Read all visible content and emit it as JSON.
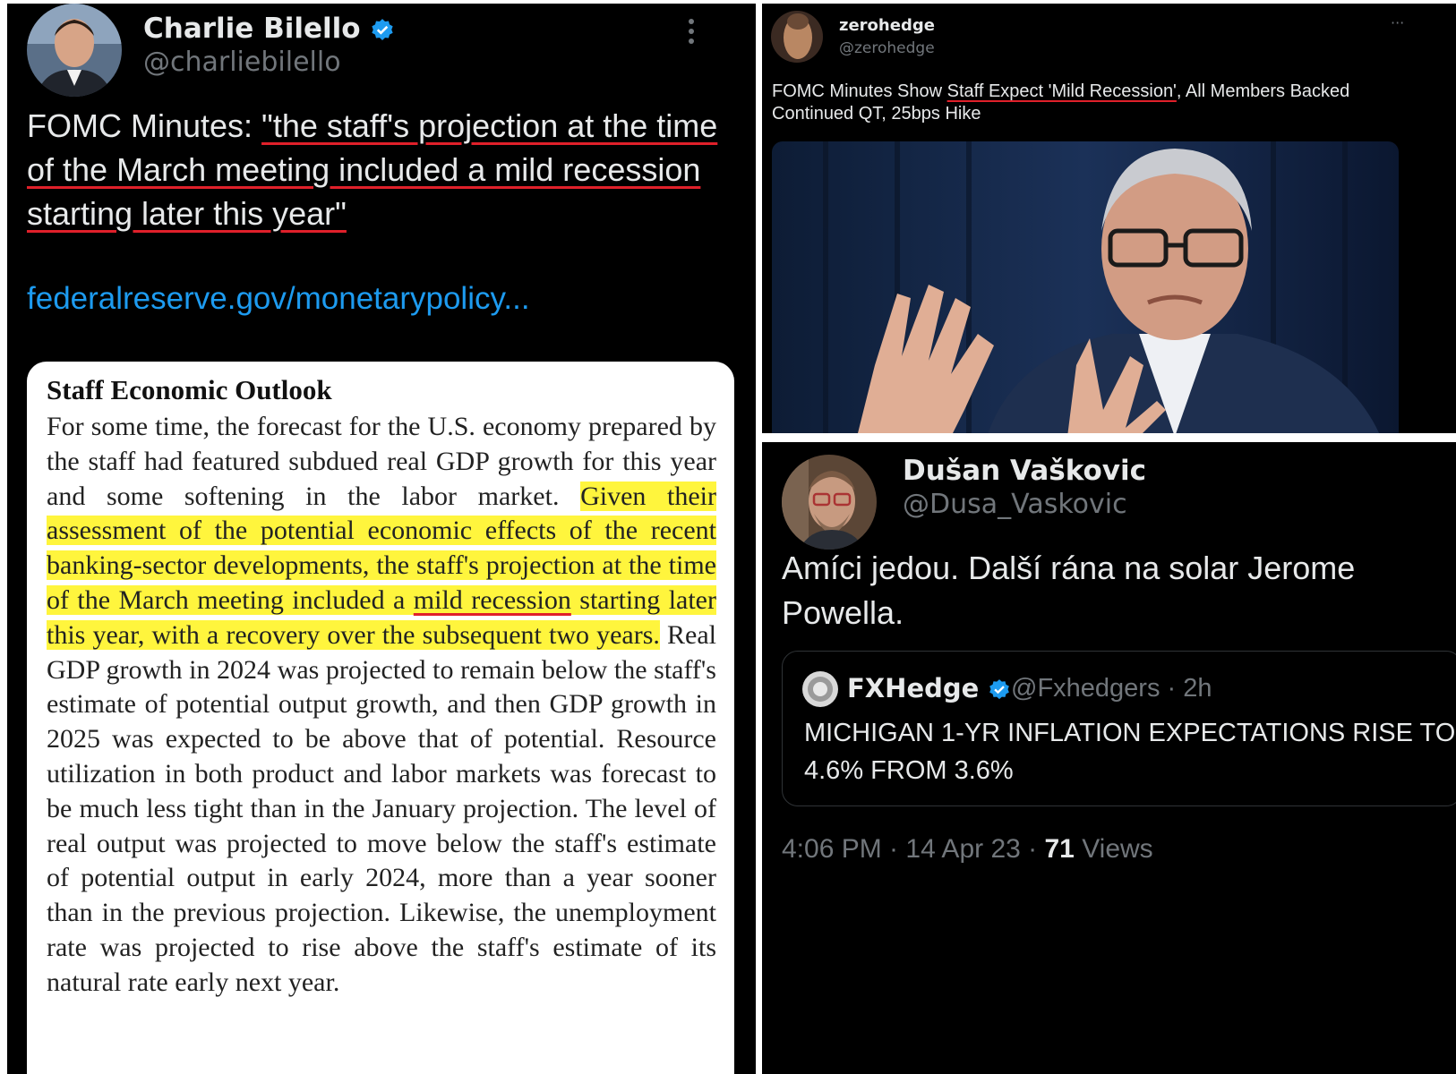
{
  "left_tweet": {
    "name": "Charlie Bilello",
    "handle": "@charliebilello",
    "text_prefix": "FOMC Minutes: ",
    "text_quote": "\"the staff's projection at the time of the March meeting included a mild recession starting later this year\"",
    "link": "federalreserve.gov/monetarypolicy...",
    "document": {
      "title": "Staff Economic Outlook",
      "para_1": "For some time, the forecast for the U.S. economy prepared by the staff had featured subdued real GDP growth for this year and some softening in the labor market. ",
      "hl_1": "Given their assessment of the potential economic effects of the recent banking-sector developments, the staff's projection at the time of the March meeting included a ",
      "hl_underlined": "mild recession",
      "hl_2": " starting later this year, with a recovery over the subsequent two years.",
      "para_2": " Real GDP growth in 2024 was projected to remain below the staff's estimate of potential output growth, and then GDP growth in 2025 was expected to be above that of potential. Resource utilization in both product and labor markets was forecast to be much less tight than in the January projection. The level of real output was projected to move below the staff's estimate of potential output in early 2024, more than a year sooner than in the previous projection. Likewise, the unemployment rate was projected to rise above the staff's estimate of its natural rate early next year."
    }
  },
  "top_right_tweet": {
    "name": "zerohedge",
    "handle": "@zerohedge",
    "more": "···",
    "text_before": "FOMC Minutes Show ",
    "text_underlined": "Staff Expect 'Mild Recession'",
    "text_after": ", All Members Backed Continued QT, 25bps Hike"
  },
  "bottom_right_tweet": {
    "name": "Dušan Vaškovic",
    "handle": "@Dusa_Vaskovic",
    "text": "Amíci jedou. Další rána na solar Jerome Powella.",
    "quoted": {
      "name": "FXHedge",
      "handle": "@Fxhedgers",
      "age": "· 2h",
      "text": "MICHIGAN 1-YR INFLATION EXPECTATIONS RISE TO 4.6% FROM 3.6%"
    },
    "time": "4:06 PM · 14 Apr 23 · ",
    "views_count": "71",
    "views_label": " Views"
  },
  "colors": {
    "background": "#000000",
    "primary_text": "#e7e9ea",
    "secondary_text": "#71767b",
    "link": "#1d9bf0",
    "underline": "#e0202a",
    "highlight": "#fff53d",
    "verified": "#1d9bf0"
  }
}
